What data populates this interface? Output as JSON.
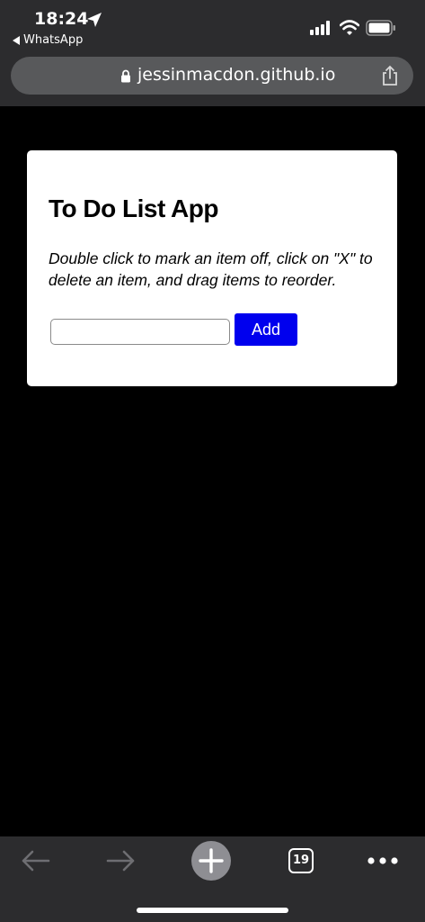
{
  "status_bar": {
    "time": "18:24",
    "back_app": "WhatsApp"
  },
  "browser": {
    "url": "jessinmacdon.github.io",
    "tab_count": "19"
  },
  "app": {
    "title": "To Do List App",
    "description": "Double click to mark an item off, click on \"X\" to delete an item, and drag items to reorder.",
    "input_value": "",
    "add_label": "Add"
  },
  "colors": {
    "add_button": "#0000ee",
    "page_background": "#000000",
    "chrome": "#2c2c2e"
  }
}
